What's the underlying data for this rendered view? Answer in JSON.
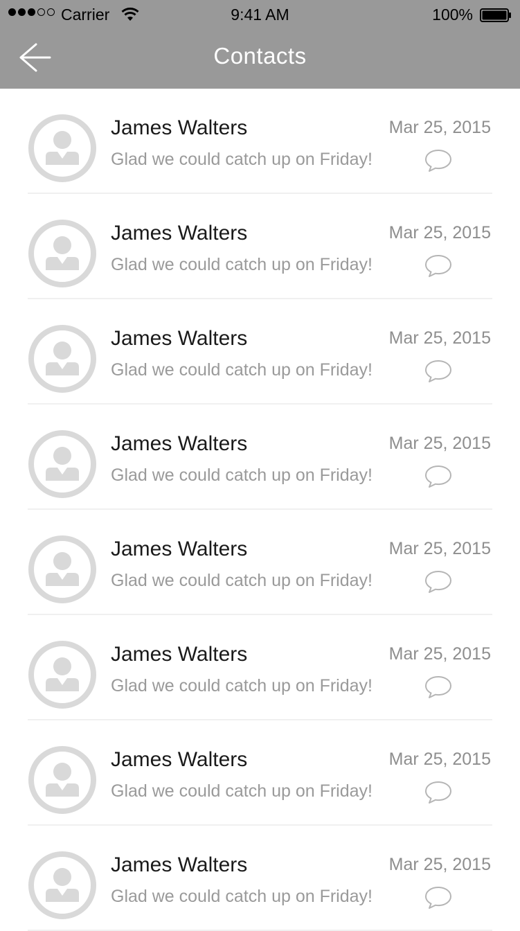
{
  "status_bar": {
    "carrier": "Carrier",
    "time": "9:41 AM",
    "battery": "100%",
    "signal_bars_filled": 3,
    "signal_bars_total": 5
  },
  "nav": {
    "title": "Contacts",
    "back_icon": "back-arrow-icon"
  },
  "colors": {
    "header_bg": "#999999",
    "avatar": "#d9d9d9",
    "divider": "#f0f0f0"
  },
  "contacts": [
    {
      "name": "James Walters",
      "date": "Mar 25, 2015",
      "message": "Glad we could catch up on Friday!",
      "icon": "chat-bubble-icon"
    },
    {
      "name": "James Walters",
      "date": "Mar 25, 2015",
      "message": "Glad we could catch up on Friday!",
      "icon": "chat-bubble-icon"
    },
    {
      "name": "James Walters",
      "date": "Mar 25, 2015",
      "message": "Glad we could catch up on Friday!",
      "icon": "chat-bubble-icon"
    },
    {
      "name": "James Walters",
      "date": "Mar 25, 2015",
      "message": "Glad we could catch up on Friday!",
      "icon": "chat-bubble-icon"
    },
    {
      "name": "James Walters",
      "date": "Mar 25, 2015",
      "message": "Glad we could catch up on Friday!",
      "icon": "chat-bubble-icon"
    },
    {
      "name": "James Walters",
      "date": "Mar 25, 2015",
      "message": "Glad we could catch up on Friday!",
      "icon": "chat-bubble-icon"
    },
    {
      "name": "James Walters",
      "date": "Mar 25, 2015",
      "message": "Glad we could catch up on Friday!",
      "icon": "chat-bubble-icon"
    },
    {
      "name": "James Walters",
      "date": "Mar 25, 2015",
      "message": "Glad we could catch up on Friday!",
      "icon": "chat-bubble-icon"
    }
  ]
}
